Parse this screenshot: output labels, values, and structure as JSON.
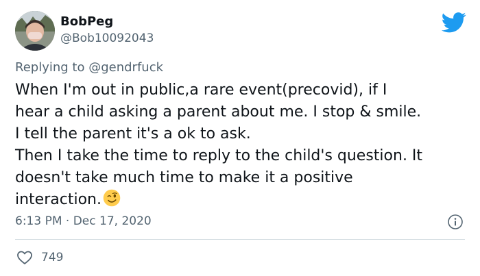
{
  "tweet": {
    "author": {
      "display_name": "BobPeg",
      "handle": "@Bob10092043",
      "avatar_icon": "profile-avatar"
    },
    "platform_icon": "twitter-bird-icon",
    "brand_color": "#1d9bf0",
    "reply": {
      "prefix": "Replying to",
      "mention": "@gendrfuck"
    },
    "text_lines": [
      "When I'm out in public,a rare event(precovid), if I",
      "hear a child asking a parent about me. I stop & smile.",
      "I tell the parent it's a ok to ask.",
      "Then I take the time to reply to the child's question. It",
      "doesn't take much time to make it a positive",
      "interaction."
    ],
    "trailing_emoji": "winking-face-emoji",
    "timestamp": "6:13 PM · Dec 17, 2020",
    "info_icon": "info-icon",
    "likes": {
      "icon": "heart-icon",
      "count": "749"
    }
  }
}
